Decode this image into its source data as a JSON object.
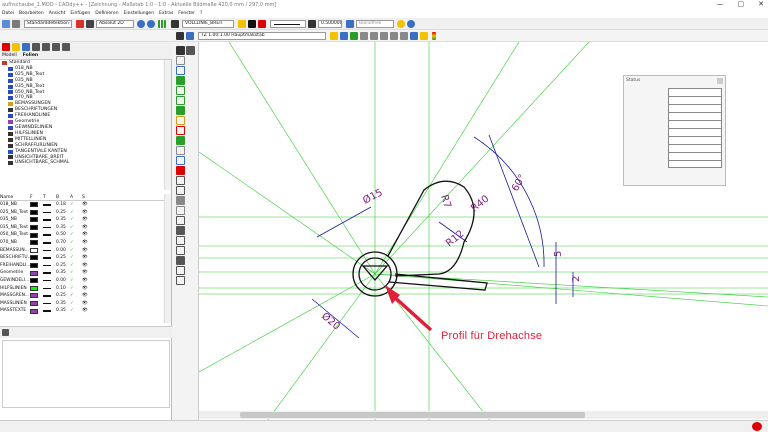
{
  "window": {
    "title": "aufhschaube_1.MOD - CADdy++ - [Zeichnung - Maßstab 1:0 - 1:0 - Aktuelle Bildmaße 420,0 mm / 297,0 mm]",
    "controls": [
      "—",
      "▢",
      "✕"
    ]
  },
  "menu": {
    "items": [
      "Datei",
      "Bearbeiten",
      "Ansicht",
      "Einfügen",
      "Definieren",
      "Einstellungen",
      "Extras",
      "Fenster",
      "?"
    ]
  },
  "toolbar1": {
    "detail_level": "Standarddetektion",
    "coord_mode": "Absolut 2D",
    "layer_name": "VOLLLINIE_BREIT",
    "line_width": "0.500000",
    "extra_field": "Bibliothek"
  },
  "toolbar2": {
    "scale_field": "TZ 1.00:1.00 Hauptmaßstab"
  },
  "left_panel": {
    "tabs": [
      "Modell",
      "Folien"
    ],
    "tree": [
      {
        "label": "Standard",
        "color": "#c0392b"
      },
      {
        "label": "018_NB",
        "color": "#2b4cc0"
      },
      {
        "label": "025_NB_Text",
        "color": "#2b4cc0"
      },
      {
        "label": "035_NB",
        "color": "#2b4cc0"
      },
      {
        "label": "035_NB_Text",
        "color": "#2b4cc0"
      },
      {
        "label": "050_NB_Text",
        "color": "#2b4cc0"
      },
      {
        "label": "070_NB",
        "color": "#2b4cc0"
      },
      {
        "label": "BEMASSUNGEN",
        "color": "#d4a017"
      },
      {
        "label": "BESCHRIFTUNGEN",
        "color": "#333333"
      },
      {
        "label": "FREIHANDLINIE",
        "color": "#2b4cc0"
      },
      {
        "label": "Geometrie",
        "color": "#8e44ad"
      },
      {
        "label": "GEWINDELINIEN",
        "color": "#2b4cc0"
      },
      {
        "label": "HILFSLINIEN",
        "color": "#333333"
      },
      {
        "label": "MITTELLINIEN",
        "color": "#333333"
      },
      {
        "label": "SCHRAFFURLINIEN",
        "color": "#333333"
      },
      {
        "label": "TANGENTIALE KANTEN",
        "color": "#2b4cc0"
      },
      {
        "label": "UNSICHTBARE_BREIT",
        "color": "#333333"
      },
      {
        "label": "UNSICHTBARE_SCHMAL",
        "color": "#333333"
      }
    ],
    "props_columns": [
      "Name",
      "F",
      "T",
      "B",
      "A",
      "S"
    ],
    "props_rows": [
      {
        "name": "018_NB",
        "color": "#000000",
        "width": "0.18"
      },
      {
        "name": "025_NB_Text",
        "color": "#000000",
        "width": "0.25"
      },
      {
        "name": "035_NB",
        "color": "#000000",
        "width": "0.35"
      },
      {
        "name": "035_NB_Text",
        "color": "#000000",
        "width": "0.35"
      },
      {
        "name": "050_NB_Text",
        "color": "#000000",
        "width": "0.50"
      },
      {
        "name": "070_NB",
        "color": "#000000",
        "width": "0.70"
      },
      {
        "name": "BEMASSUN...",
        "color": "#ffffff",
        "width": "0.00"
      },
      {
        "name": "BESCHRIFTU...",
        "color": "#000000",
        "width": "0.25"
      },
      {
        "name": "FREIHANDLI...",
        "color": "#000000",
        "width": "0.25"
      },
      {
        "name": "Geometrie",
        "color": "#8e44ad",
        "width": "0.35"
      },
      {
        "name": "GEWINDELI...",
        "color": "#000000",
        "width": "0.00"
      },
      {
        "name": "HILFSLINIEN",
        "color": "#00ff00",
        "width": "0.10"
      },
      {
        "name": "MASSGREN...",
        "color": "#8e44ad",
        "width": "0.25"
      },
      {
        "name": "MASSLINIEN",
        "color": "#8e44ad",
        "width": "0.35"
      },
      {
        "name": "MASSTEXTE",
        "color": "#8e44ad",
        "width": "0.35"
      }
    ],
    "check_glyph": "✓",
    "eye_glyph": "👁"
  },
  "drawing": {
    "dims": {
      "d15": "Ø15",
      "d20": "Ø20",
      "r7": "R7",
      "r40": "R40",
      "r12": "R12",
      "a60": "60°",
      "v5": "5",
      "v2": "2"
    },
    "annotation": "Profil für Drehachse",
    "colors": {
      "helper": "#33cc33",
      "dimension": "#1a1a9e",
      "geometry": "#111111",
      "annotation": "#e0203a"
    }
  },
  "status_panel": {
    "title": "Status"
  }
}
